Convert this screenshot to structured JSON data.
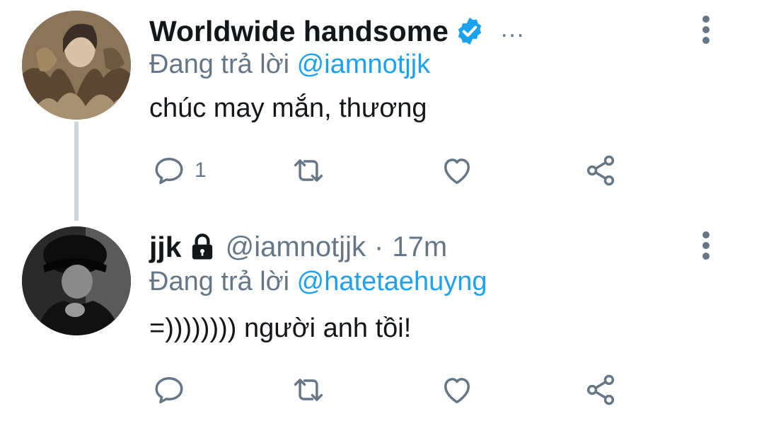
{
  "tweets": [
    {
      "display_name": "Worldwide handsome",
      "verified": true,
      "more_label": "...",
      "reply_prefix": "Đang trả lời",
      "reply_to": "@iamnotjjk",
      "text": "chúc may mắn, thương",
      "reply_count": "1",
      "avatar_icon": "avatar-photo"
    },
    {
      "display_name": "jjk",
      "locked": true,
      "handle": "@iamnotjjk",
      "separator": "·",
      "time": "17m",
      "reply_prefix": "Đang trả lời",
      "reply_to": "@hatetaehuyng",
      "text": "=)))))))) người anh tồi!",
      "avatar_icon": "avatar-photo"
    }
  ],
  "colors": {
    "link": "#1da1f2",
    "secondary_text": "#657786",
    "primary_text": "#14171a",
    "thread_line": "#d0d8de"
  },
  "icons": [
    "reply-icon",
    "retweet-icon",
    "like-icon",
    "share-icon",
    "verified-badge-icon",
    "lock-icon",
    "more-options-icon"
  ]
}
